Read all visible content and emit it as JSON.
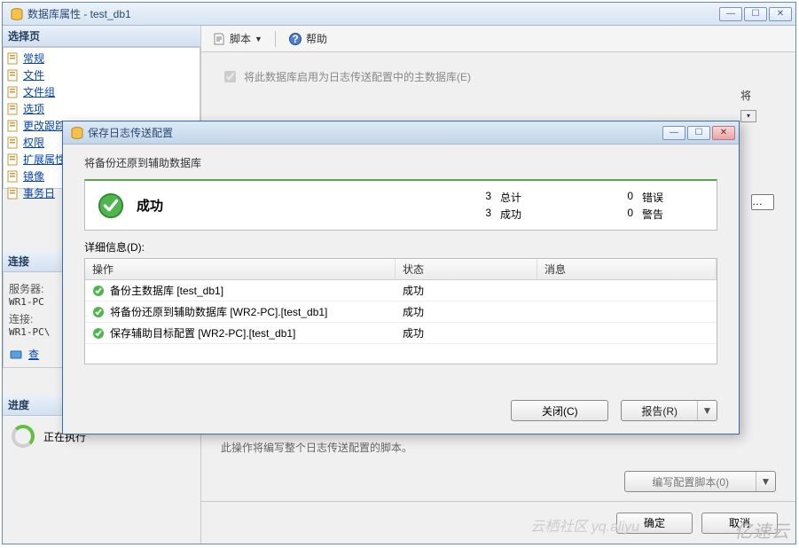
{
  "main": {
    "title": "数据库属性 - test_db1",
    "select_page_header": "选择页",
    "pages": [
      "常规",
      "文件",
      "文件组",
      "选项",
      "更改跟踪",
      "权限",
      "扩展属性",
      "镜像",
      "事务日"
    ],
    "connection": {
      "header": "连接",
      "server_label": "服务器:",
      "server_value": "WR1-PC",
      "conn_label": "连接:",
      "conn_value": "WR1-PC\\",
      "view_link": "查"
    },
    "progress": {
      "header": "进度",
      "text": "正在执行"
    },
    "toolbar": {
      "script": "脚本",
      "help": "帮助"
    },
    "checkbox_label": "将此数据库启用为日志传送配置中的主数据库(E)",
    "side_char": "将",
    "hint": "此操作将编写整个日志传送配置的脚本。",
    "script_button": "编写配置脚本(0)",
    "ok": "确定",
    "cancel": "取消"
  },
  "modal": {
    "title": "保存日志传送配置",
    "restore_label": "将备份还原到辅助数据库",
    "status": {
      "success_title": "成功",
      "total_num": "3",
      "total_label": "总计",
      "success_num": "3",
      "success_label": "成功",
      "error_num": "0",
      "error_label": "错误",
      "warn_num": "0",
      "warn_label": "警告"
    },
    "details_label": "详细信息(D):",
    "headers": {
      "op": "操作",
      "status": "状态",
      "msg": "消息"
    },
    "rows": [
      {
        "op": "备份主数据库 [test_db1]",
        "status": "成功",
        "msg": ""
      },
      {
        "op": "将备份还原到辅助数据库 [WR2-PC].[test_db1]",
        "status": "成功",
        "msg": ""
      },
      {
        "op": "保存辅助目标配置 [WR2-PC].[test_db1]",
        "status": "成功",
        "msg": ""
      }
    ],
    "close_btn": "关闭(C)",
    "report_btn": "报告(R)"
  },
  "watermark": "亿速云",
  "watermark2": "云栖社区 yq.aliyu"
}
